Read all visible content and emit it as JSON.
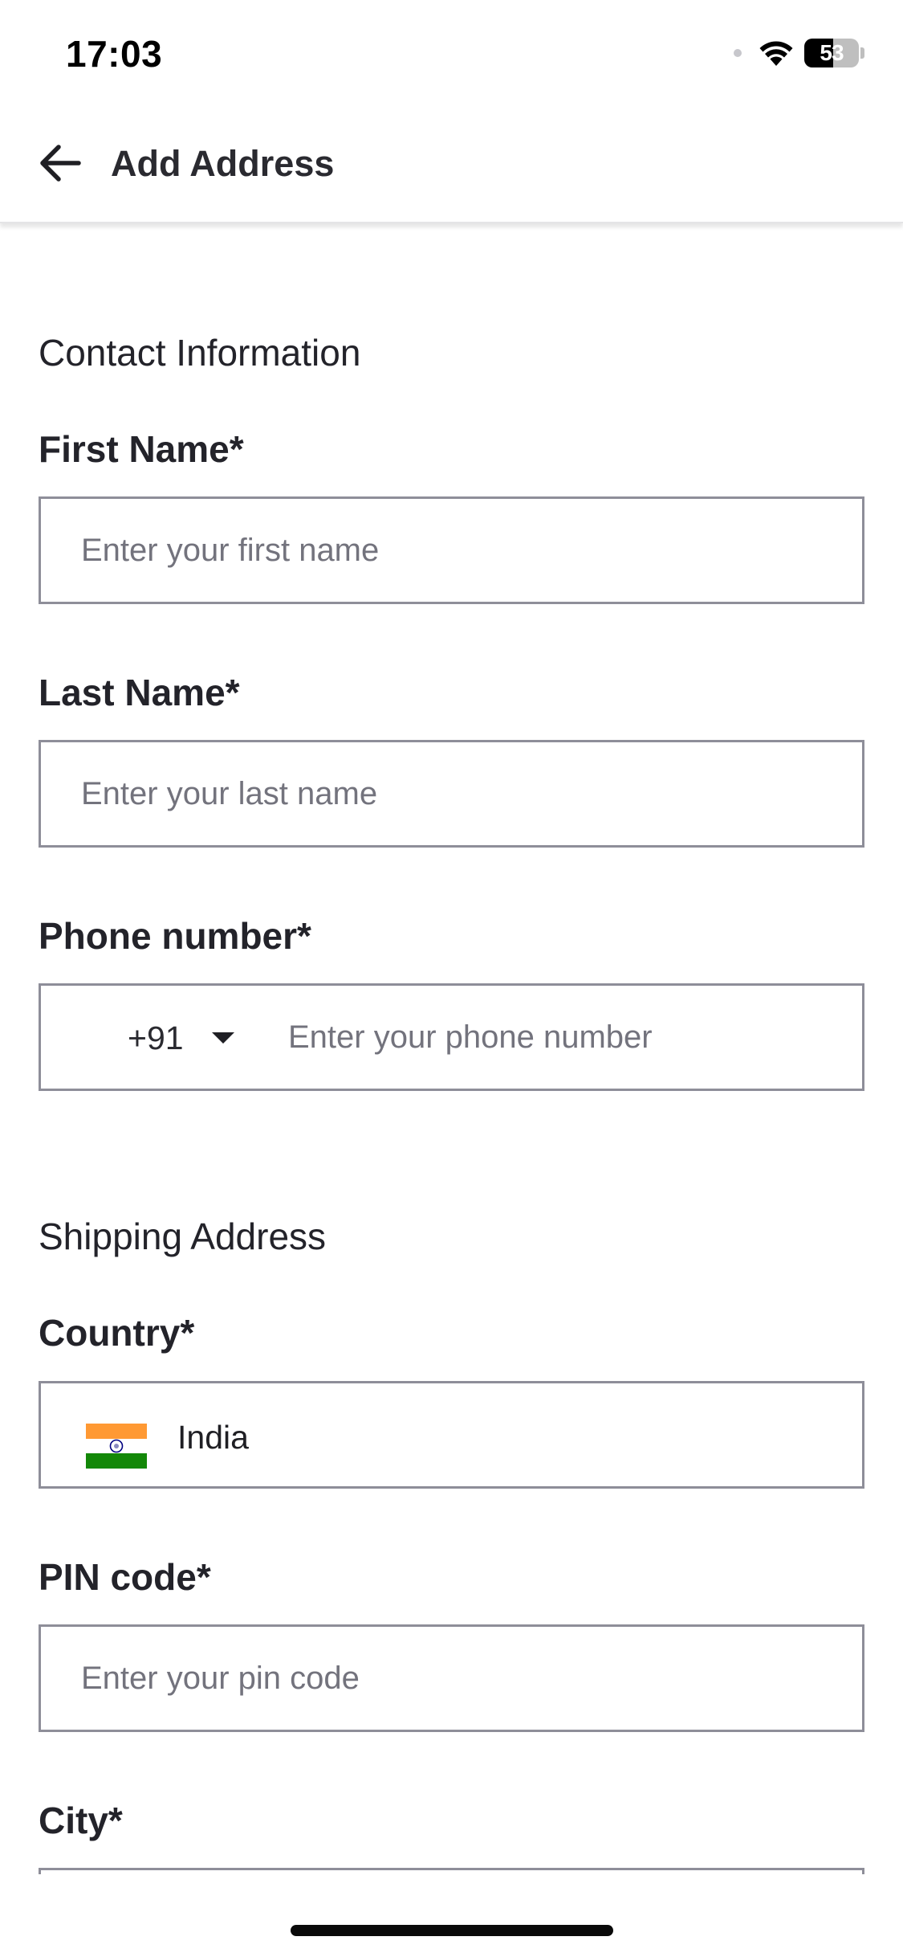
{
  "status_bar": {
    "time": "17:03",
    "battery_level": "53"
  },
  "header": {
    "title": "Add Address"
  },
  "contact_section": {
    "title": "Contact Information",
    "first_name": {
      "label": "First Name*",
      "placeholder": "Enter your first name"
    },
    "last_name": {
      "label": "Last Name*",
      "placeholder": "Enter your last name"
    },
    "phone": {
      "label": "Phone number*",
      "country_code": "+91",
      "placeholder": "Enter your phone number"
    }
  },
  "shipping_section": {
    "title": "Shipping Address",
    "country": {
      "label": "Country*",
      "value": "India",
      "flag_colors": [
        "#ff9933",
        "#ffffff",
        "#138808"
      ]
    },
    "pin_code": {
      "label": "PIN code*",
      "placeholder": "Enter your pin code"
    },
    "city": {
      "label": "City*"
    }
  },
  "icons": [
    "back-arrow-icon",
    "wifi-icon",
    "battery-icon",
    "caret-down-icon",
    "india-flag-icon"
  ]
}
